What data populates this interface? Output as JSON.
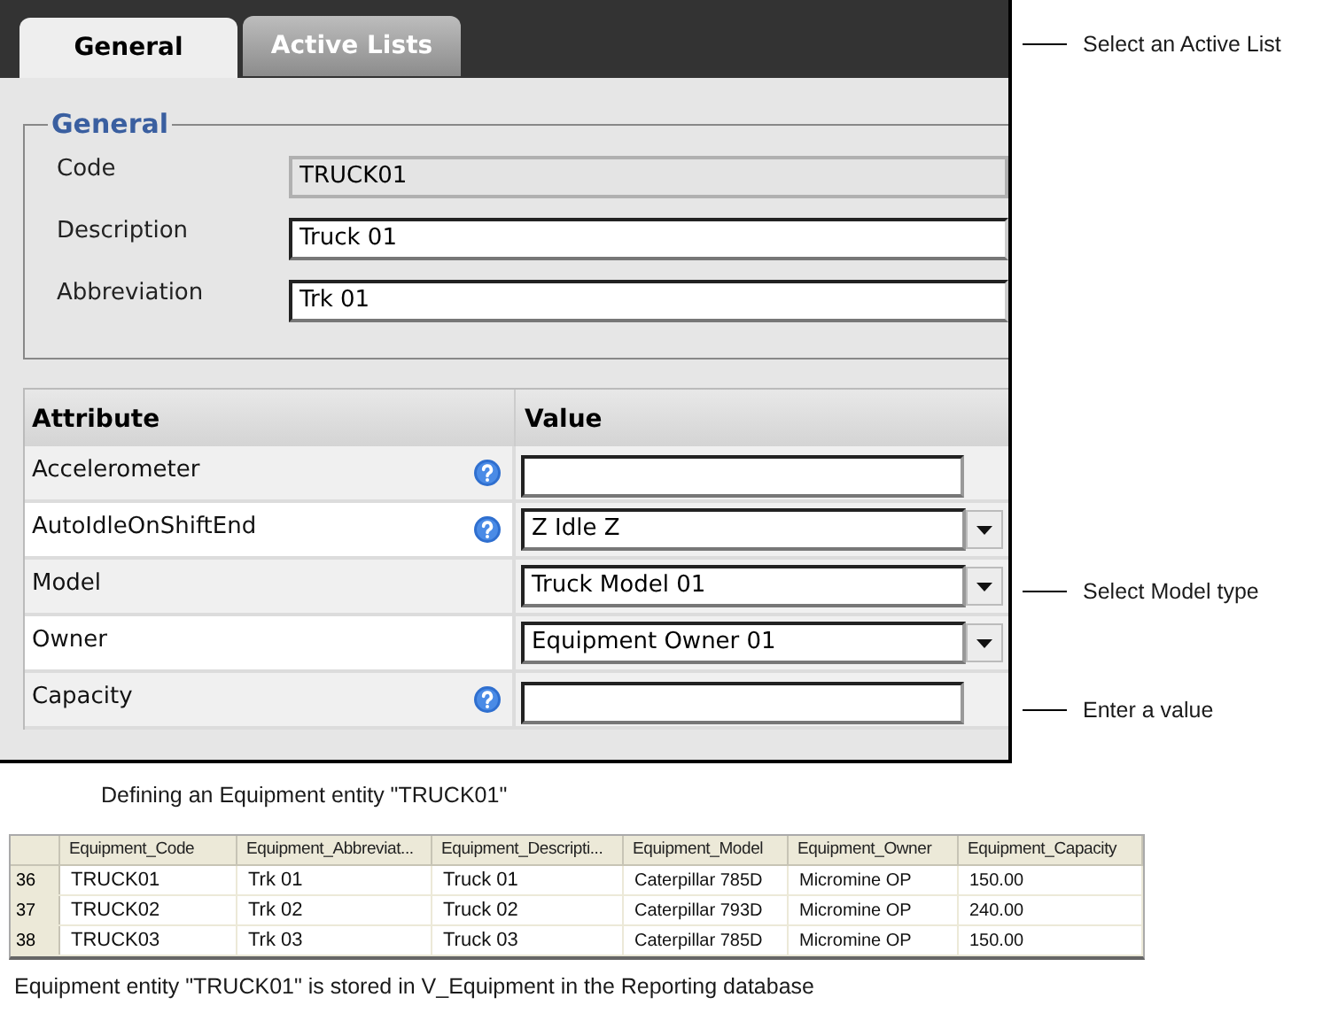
{
  "tabs": [
    {
      "label": "General",
      "selected": true
    },
    {
      "label": "Active Lists",
      "selected": false
    }
  ],
  "general": {
    "legend": "General",
    "fields": [
      {
        "label": "Code",
        "value": "TRUCK01",
        "readonly": true
      },
      {
        "label": "Description",
        "value": "Truck 01",
        "readonly": false
      },
      {
        "label": "Abbreviation",
        "value": "Trk 01",
        "readonly": false
      }
    ]
  },
  "attributes": {
    "columns": [
      "Attribute",
      "Value"
    ],
    "rows": [
      {
        "name": "Accelerometer",
        "help": true,
        "kind": "text",
        "value": ""
      },
      {
        "name": "AutoIdleOnShiftEnd",
        "help": true,
        "kind": "dropdown",
        "value": "Z Idle Z"
      },
      {
        "name": "Model",
        "help": false,
        "kind": "dropdown",
        "value": "Truck Model 01"
      },
      {
        "name": "Owner",
        "help": false,
        "kind": "dropdown",
        "value": "Equipment Owner 01"
      },
      {
        "name": "Capacity",
        "help": true,
        "kind": "text",
        "value": ""
      }
    ]
  },
  "annotations": [
    {
      "text": "Select an Active List"
    },
    {
      "text": "Select Model type"
    },
    {
      "text": "Enter a value"
    }
  ],
  "caption": "Defining an Equipment entity \"TRUCK01\"",
  "grid": {
    "columns": [
      "Equipment_Code",
      "Equipment_Abbreviat...",
      "Equipment_Descripti...",
      "Equipment_Model",
      "Equipment_Owner",
      "Equipment_Capacity"
    ],
    "rows": [
      {
        "number": "36",
        "cells": [
          "TRUCK01",
          "Trk 01",
          "Truck 01",
          "Caterpillar 785D",
          "Micromine OP",
          "150.00"
        ]
      },
      {
        "number": "37",
        "cells": [
          "TRUCK02",
          "Trk 02",
          "Truck 02",
          "Caterpillar 793D",
          "Micromine OP",
          "240.00"
        ]
      },
      {
        "number": "38",
        "cells": [
          "TRUCK03",
          "Trk 03",
          "Truck 03",
          "Caterpillar 785D",
          "Micromine OP",
          "150.00"
        ]
      }
    ]
  },
  "footnote": "Equipment entity \"TRUCK01\" is stored in V_Equipment in the Reporting database"
}
